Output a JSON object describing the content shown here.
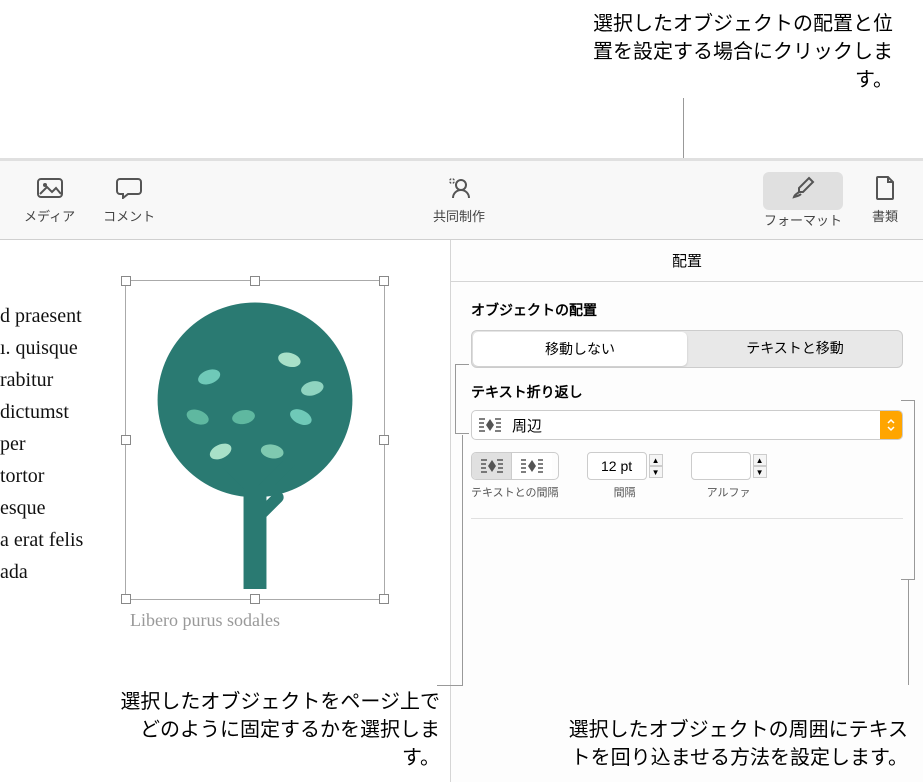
{
  "callouts": {
    "top": "選択したオブジェクトの配置と位置を設定する場合にクリックします。",
    "bottom_left": "選択したオブジェクトをページ上でどのように固定するかを選択します。",
    "bottom_right": "選択したオブジェクトの周囲にテキストを回り込ませる方法を設定します。"
  },
  "toolbar": {
    "media": "メディア",
    "comment": "コメント",
    "collab": "共同制作",
    "format": "フォーマット",
    "document": "書類"
  },
  "sidebar": {
    "tab": "配置",
    "section": "オブジェクトの配置",
    "seg_left": "移動しない",
    "seg_right": "テキストと移動",
    "wrap_title": "テキスト折り返し",
    "wrap_value": "周辺",
    "spacing_label": "テキストとの間隔",
    "gap_label": "間隔",
    "gap_value": "12 pt",
    "alpha_label": "アルファ"
  },
  "document": {
    "lines": [
      "d praesent",
      "ı. quisque",
      "rabitur",
      "dictumst",
      "per",
      "tortor",
      "",
      "esque",
      "a erat felis",
      "ada"
    ],
    "caption": "Libero purus sodales"
  }
}
